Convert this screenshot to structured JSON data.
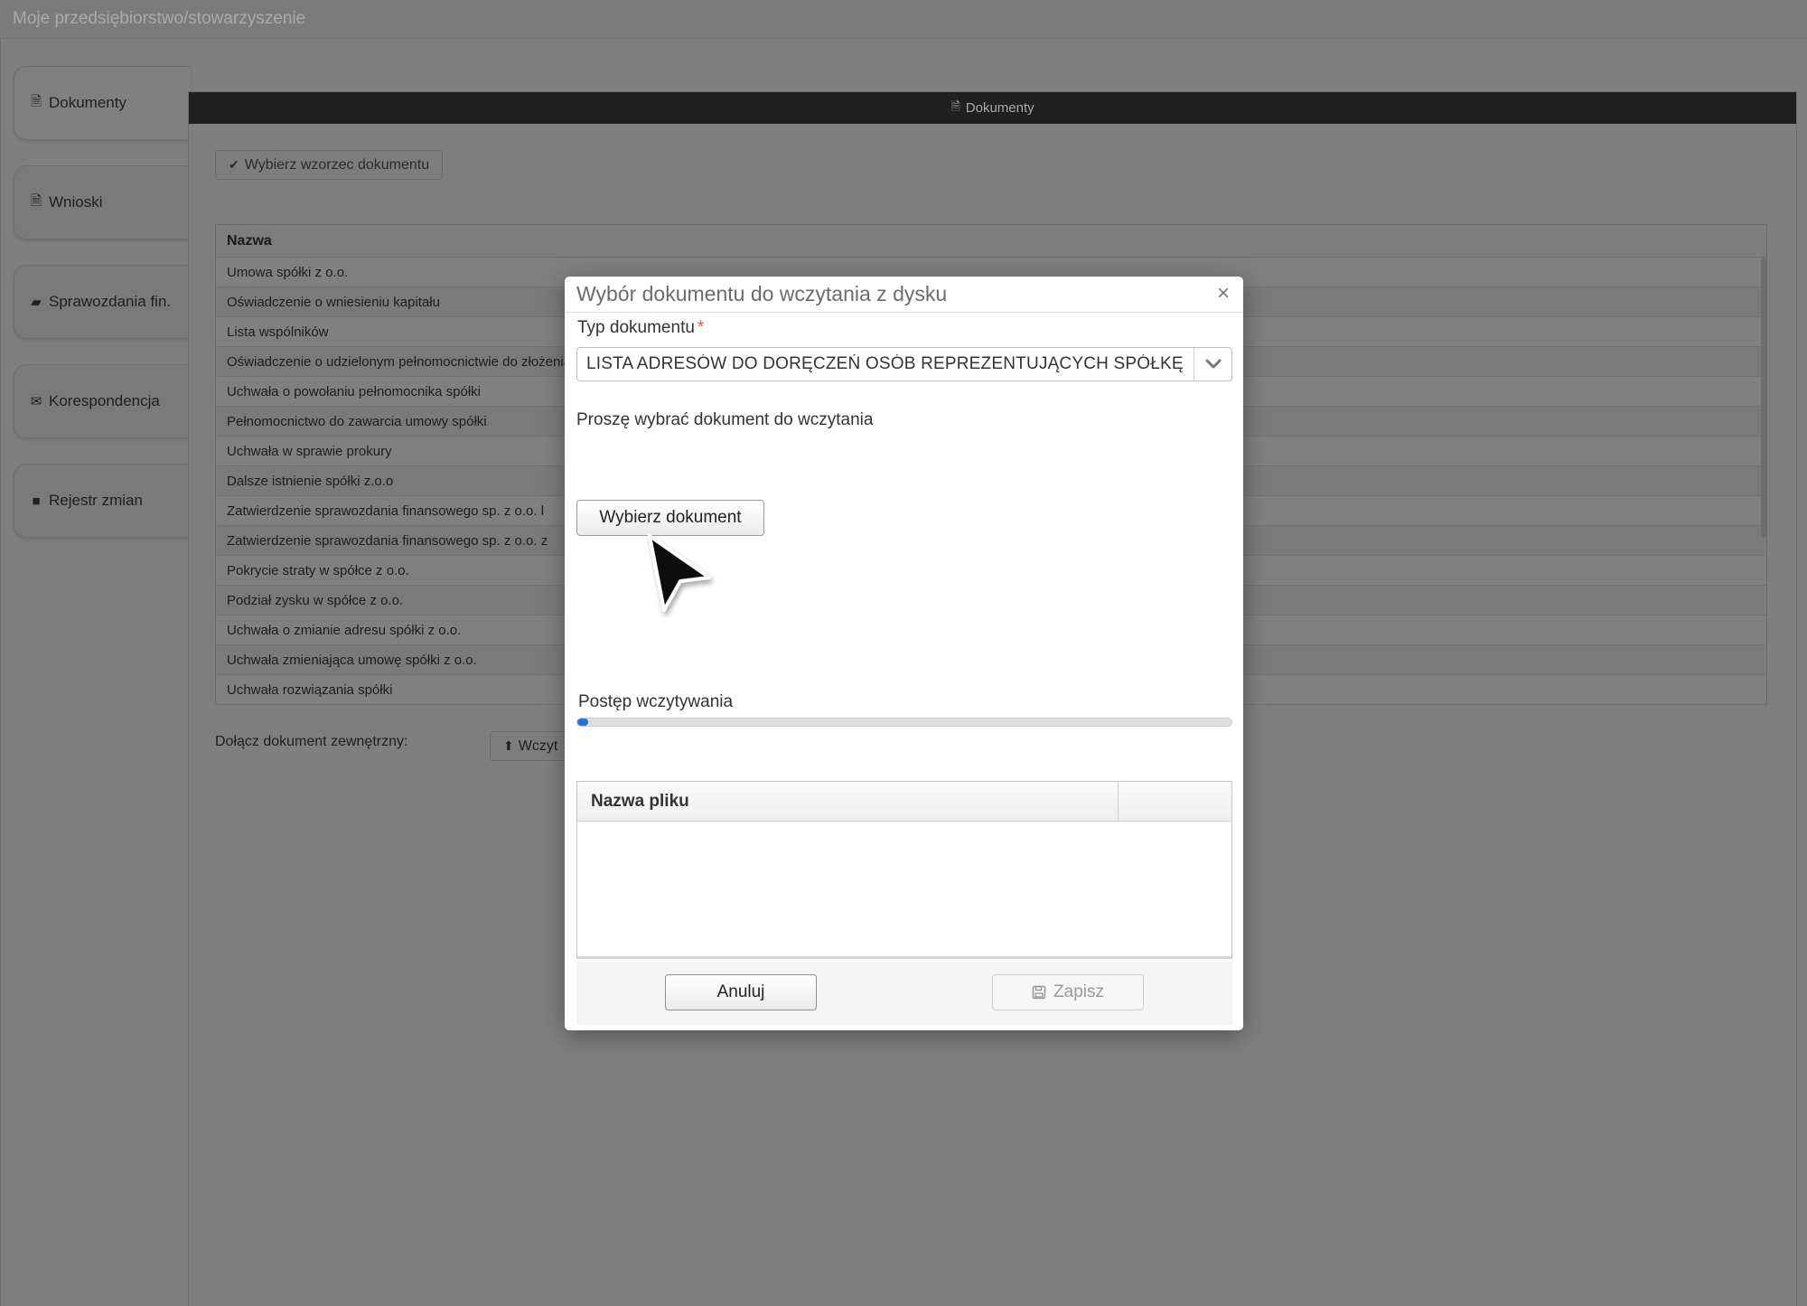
{
  "app": {
    "title": "Moje przedsiębiorstwo/stowarzyszenie"
  },
  "sidebar": {
    "items": [
      {
        "label": "Dokumenty",
        "icon": "file-icon"
      },
      {
        "label": "Wnioski",
        "icon": "file-text-icon"
      },
      {
        "label": "Sprawozdania fin.",
        "icon": "folder-open-icon"
      },
      {
        "label": "Korespondencja",
        "icon": "envelope-icon"
      },
      {
        "label": "Rejestr zmian",
        "icon": "briefcase-icon"
      }
    ]
  },
  "panel": {
    "header": "Dokumenty",
    "choose_template_label": "Wybierz wzorzec dokumentu",
    "table_header": "Nazwa",
    "documents": [
      "Umowa spółki z o.o.",
      "Oświadczenie o wniesieniu kapitału",
      "Lista wspólników",
      "Oświadczenie o udzielonym pełnomocnictwie do złożenia",
      "Uchwała o powołaniu pełnomocnika spółki",
      "Pełnomocnictwo do zawarcia umowy spółki",
      "Uchwała w sprawie prokury",
      "Dalsze istnienie spółki z.o.o",
      "Zatwierdzenie sprawozdania finansowego sp. z o.o. l",
      "Zatwierdzenie sprawozdania finansowego sp. z o.o. z",
      "Pokrycie straty w spółce z o.o.",
      "Podział zysku w spółce z o.o.",
      "Uchwała o zmianie adresu spółki z o.o.",
      "Uchwała zmieniająca umowę spółki z o.o.",
      "Uchwała rozwiązania spółki"
    ],
    "attach_label": "Dołącz dokument zewnętrzny:",
    "attach_button": "Wczyt"
  },
  "modal": {
    "title": "Wybór dokumentu do wczytania z dysku",
    "close_symbol": "×",
    "doc_type_label": "Typ dokumentu",
    "required_mark": "*",
    "doc_type_value": "LISTA ADRESÓW DO  DORĘCZEŃ   OSÓB REPREZENTUJĄCYCH SPÓŁKĘ",
    "instruction": "Proszę wybrać dokument do wczytania",
    "choose_button": "Wybierz dokument",
    "progress_label": "Postęp wczytywania",
    "progress_value": 0.01,
    "file_table_header": "Nazwa pliku",
    "cancel_button": "Anuluj",
    "save_button": "Zapisz"
  },
  "colors": {
    "accent": "#1e74d9",
    "required": "#d9534f",
    "panel_header": "#202020",
    "overlay": "#7f7f7f"
  }
}
